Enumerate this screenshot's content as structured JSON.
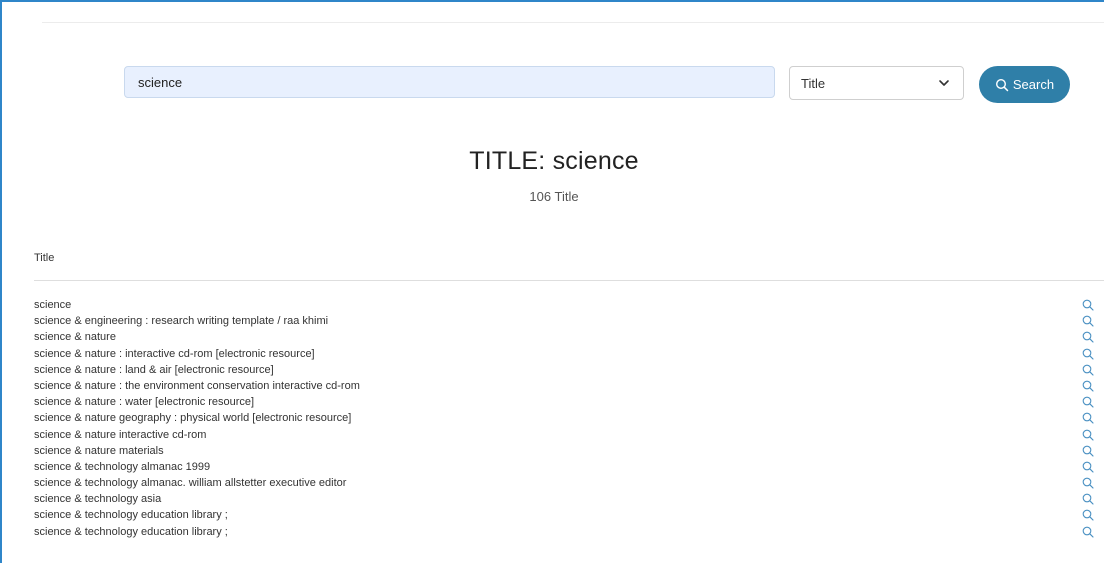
{
  "search": {
    "value": "science",
    "field_selected": "Title",
    "button_label": "Search"
  },
  "results_header": {
    "title": "TITLE: science",
    "count": "106 Title"
  },
  "table": {
    "column_header": "Title",
    "rows": [
      "science",
      "science & engineering : research writing template / raa khimi",
      "science & nature",
      "science & nature : interactive cd-rom [electronic resource]",
      "science & nature : land & air [electronic resource]",
      "science & nature : the environment conservation interactive cd-rom",
      "science & nature : water [electronic resource]",
      "science & nature geography : physical world [electronic resource]",
      "science & nature interactive cd-rom",
      "science & nature materials",
      "science & technology almanac 1999",
      "science & technology almanac. william allstetter executive editor",
      "science & technology asia",
      "science & technology education library ;",
      "science & technology education library ;"
    ]
  },
  "icons": {
    "search_button_icon": "search-icon",
    "row_action_icon": "search-icon",
    "select_icon": "chevron-down-icon"
  },
  "colors": {
    "accent": "#2f7fa8",
    "frame": "#2f86c9",
    "input_bg": "#e8f0fe",
    "row_icon": "#4a90c2"
  }
}
